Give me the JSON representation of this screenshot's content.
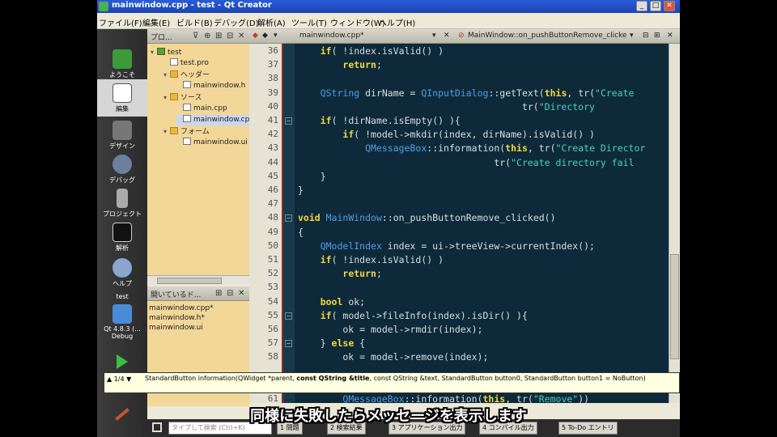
{
  "window": {
    "title": "mainwindow.cpp - test - Qt Creator"
  },
  "menu": [
    "ファイル(F)",
    "編集(E)",
    "ビルド(B)",
    "デバッグ(D)",
    "解析(A)",
    "ツール(T)",
    "ウィンドウ(W)",
    "ヘルプ(H)"
  ],
  "modes": [
    {
      "label": "ようこそ",
      "icon": "qt-logo-icon"
    },
    {
      "label": "編集",
      "icon": "edit-icon"
    },
    {
      "label": "デザイン",
      "icon": "design-icon"
    },
    {
      "label": "デバッグ",
      "icon": "debug-icon"
    },
    {
      "label": "プロジェクト",
      "icon": "project-icon"
    },
    {
      "label": "解析",
      "icon": "analyze-icon"
    },
    {
      "label": "ヘルプ",
      "icon": "help-icon"
    }
  ],
  "kit": {
    "project": "test",
    "label": "Qt 4.8.3 (... Debug"
  },
  "project_panel": {
    "title": "プロ..."
  },
  "tree": [
    {
      "label": "test",
      "type": "proj",
      "expand": "▾",
      "indent": 0
    },
    {
      "label": "test.pro",
      "type": "file",
      "expand": "",
      "indent": 1
    },
    {
      "label": "ヘッダー",
      "type": "folder",
      "expand": "▾",
      "indent": 1
    },
    {
      "label": "mainwindow.h",
      "type": "file",
      "expand": "",
      "indent": 2
    },
    {
      "label": "ソース",
      "type": "folder",
      "expand": "▾",
      "indent": 1
    },
    {
      "label": "main.cpp",
      "type": "file",
      "expand": "",
      "indent": 2
    },
    {
      "label": "mainwindow.cpp",
      "type": "file",
      "expand": "",
      "indent": 2,
      "selected": true
    },
    {
      "label": "フォーム",
      "type": "folder",
      "expand": "▾",
      "indent": 1
    },
    {
      "label": "mainwindow.ui",
      "type": "file",
      "expand": "",
      "indent": 2
    }
  ],
  "open_docs": {
    "title": "開いているド...",
    "items": [
      "mainwindow.cpp*",
      "mainwindow.h*",
      "mainwindow.ui"
    ]
  },
  "editor": {
    "file_tab": "mainwindow.cpp*",
    "symbol": "MainWindow::on_pushButtonRemove_clicked()",
    "lines": [
      {
        "n": "36",
        "fold": "",
        "tokens": [
          [
            "c",
            "    "
          ],
          [
            "k",
            "if"
          ],
          [
            "c",
            "( !index."
          ],
          [
            "fn",
            "isValid"
          ],
          [
            "c",
            "() )"
          ]
        ]
      },
      {
        "n": "37",
        "fold": "",
        "tokens": [
          [
            "c",
            "        "
          ],
          [
            "k",
            "return"
          ],
          [
            "c",
            ";"
          ]
        ]
      },
      {
        "n": "38",
        "fold": "",
        "tokens": []
      },
      {
        "n": "39",
        "fold": "",
        "tokens": [
          [
            "c",
            "    "
          ],
          [
            "ty",
            "QString"
          ],
          [
            "c",
            " dirName = "
          ],
          [
            "ty",
            "QInputDialog"
          ],
          [
            "c",
            "::getText("
          ],
          [
            "k",
            "this"
          ],
          [
            "c",
            ", tr("
          ],
          [
            "s",
            "\"Create"
          ]
        ]
      },
      {
        "n": "40",
        "fold": "",
        "tokens": [
          [
            "c",
            "                                        tr("
          ],
          [
            "s",
            "\"Directory"
          ]
        ]
      },
      {
        "n": "41",
        "fold": "⊟",
        "tokens": [
          [
            "c",
            "    "
          ],
          [
            "k",
            "if"
          ],
          [
            "c",
            "( !dirName."
          ],
          [
            "fn",
            "isEmpty"
          ],
          [
            "c",
            "() ){"
          ]
        ]
      },
      {
        "n": "42",
        "fold": "",
        "tokens": [
          [
            "c",
            "        "
          ],
          [
            "k",
            "if"
          ],
          [
            "c",
            "( !model->mkdir(index, dirName).isValid() )"
          ]
        ]
      },
      {
        "n": "43",
        "fold": "",
        "tokens": [
          [
            "c",
            "            "
          ],
          [
            "ty",
            "QMessageBox"
          ],
          [
            "c",
            "::information("
          ],
          [
            "k",
            "this"
          ],
          [
            "c",
            ", tr("
          ],
          [
            "s",
            "\"Create Director"
          ]
        ]
      },
      {
        "n": "44",
        "fold": "",
        "tokens": [
          [
            "c",
            "                                   tr("
          ],
          [
            "s",
            "\"Create directory fail"
          ]
        ]
      },
      {
        "n": "45",
        "fold": "",
        "tokens": [
          [
            "c",
            "    }"
          ]
        ]
      },
      {
        "n": "46",
        "fold": "",
        "tokens": [
          [
            "c",
            "}"
          ]
        ]
      },
      {
        "n": "47",
        "fold": "",
        "tokens": []
      },
      {
        "n": "48",
        "fold": "⊟",
        "tokens": [
          [
            "k",
            "void"
          ],
          [
            "c",
            " "
          ],
          [
            "ty",
            "MainWindow"
          ],
          [
            "c",
            "::on_pushButtonRemove_clicked()"
          ]
        ]
      },
      {
        "n": "49",
        "fold": "",
        "tokens": [
          [
            "c",
            "{"
          ]
        ]
      },
      {
        "n": "50",
        "fold": "",
        "tokens": [
          [
            "c",
            "    "
          ],
          [
            "ty",
            "QModelIndex"
          ],
          [
            "c",
            " index = ui->treeView->currentIndex();"
          ]
        ]
      },
      {
        "n": "51",
        "fold": "",
        "tokens": [
          [
            "c",
            "    "
          ],
          [
            "k",
            "if"
          ],
          [
            "c",
            "( !index.isValid() )"
          ]
        ]
      },
      {
        "n": "52",
        "fold": "",
        "tokens": [
          [
            "c",
            "        "
          ],
          [
            "k",
            "return"
          ],
          [
            "c",
            ";"
          ]
        ]
      },
      {
        "n": "53",
        "fold": "",
        "tokens": []
      },
      {
        "n": "54",
        "fold": "",
        "tokens": [
          [
            "c",
            "    "
          ],
          [
            "k",
            "bool"
          ],
          [
            "c",
            " ok;"
          ]
        ]
      },
      {
        "n": "55",
        "fold": "⊟",
        "tokens": [
          [
            "c",
            "    "
          ],
          [
            "k",
            "if"
          ],
          [
            "c",
            "( model->fileInfo(index).isDir() ){"
          ]
        ]
      },
      {
        "n": "56",
        "fold": "",
        "tokens": [
          [
            "c",
            "        ok = model->rmdir(index);"
          ]
        ]
      },
      {
        "n": "57",
        "fold": "⊟",
        "tokens": [
          [
            "c",
            "    } "
          ],
          [
            "k",
            "else"
          ],
          [
            "c",
            " {"
          ]
        ]
      },
      {
        "n": "58",
        "fold": "",
        "tokens": [
          [
            "c",
            "        ok = model->remove(index);"
          ]
        ]
      }
    ],
    "tail_line": {
      "n": "61",
      "fold": "",
      "tokens": [
        [
          "c",
          "        "
        ],
        [
          "ty",
          "QMessageBox"
        ],
        [
          "c",
          "::information("
        ],
        [
          "k",
          "this"
        ],
        [
          "c",
          ", tr("
        ],
        [
          "s",
          "\"Remove\""
        ],
        [
          "c",
          "))"
        ]
      ]
    }
  },
  "tooltip": {
    "nav": "▲ 1/4 ▼",
    "signature_pre": "StandardButton information(QWidget *parent, ",
    "signature_bold": "const QString &title",
    "signature_post": ", const QString &text, StandardButton button0, StandardButton button1 = NoButton)"
  },
  "bottom": {
    "search_placeholder": "タイプして検索 (Ctrl+K)",
    "tabs": [
      "1 問題",
      "2 検索結果",
      "3 アプリケーション出力",
      "4 コンパイル出力",
      "5 To-Do エントリ"
    ]
  },
  "subtitle": "同様に失敗したらメッセージを表示します"
}
